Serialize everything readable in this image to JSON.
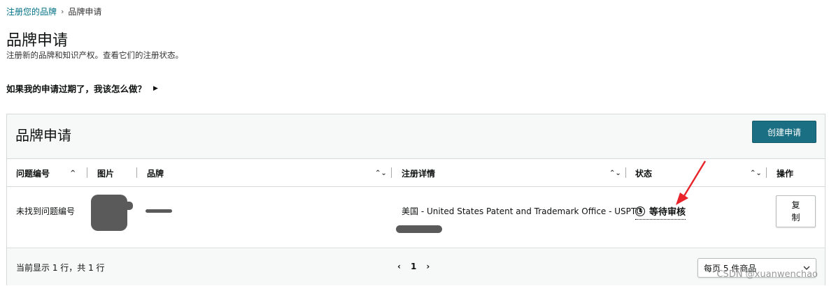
{
  "breadcrumb": {
    "link": "注册您的品牌",
    "separator": "›",
    "current": "品牌申请"
  },
  "page": {
    "title": "品牌申请",
    "subtitle": "注册新的品牌和知识产权。查看它们的注册状态。"
  },
  "faq": {
    "label": "如果我的申请过期了，我该怎么做？",
    "caret": "▶"
  },
  "panel": {
    "title": "品牌申请",
    "create_button": "创建申请",
    "columns": [
      "问题编号",
      "图片",
      "品牌",
      "注册详情",
      "状态",
      "操作"
    ],
    "sort_icons": {
      "up": "^",
      "both": "⌃⌄"
    },
    "rows": [
      {
        "issue_id": "未找到问题编号",
        "registration": "美国 - United States Patent and Trademark Office - USPTO",
        "status": "等待审核",
        "action": "复制"
      }
    ],
    "footer": {
      "summary": "当前显示 1 行，共 1 行",
      "prev": "‹",
      "page": "1",
      "next": "›",
      "per_page": "每页 5 件商品"
    }
  },
  "watermark": "CSDN @xuanwenchao",
  "colors": {
    "accent": "#1b6f82",
    "link": "#007185",
    "annotation_arrow": "#e8232a"
  }
}
